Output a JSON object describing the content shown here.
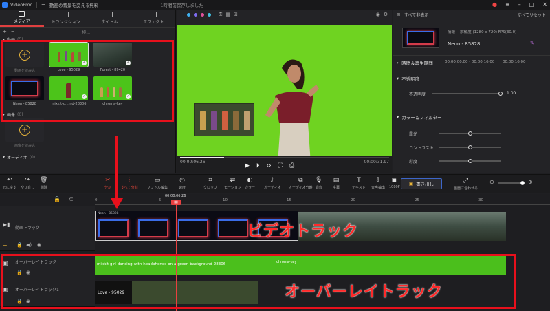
{
  "app": {
    "name": "VideoProc",
    "project_title": "動画の背景を変える無料",
    "status": "1時間前保存しました"
  },
  "left_panel": {
    "tabs": [
      {
        "label": "メディア",
        "icon": "media-icon"
      },
      {
        "label": "トランジション",
        "icon": "transition-icon"
      },
      {
        "label": "タイトル",
        "icon": "title-icon"
      },
      {
        "label": "エフェクト",
        "icon": "effect-icon"
      }
    ],
    "search_placeholder": "検...",
    "video_section": {
      "label": "動画",
      "count": "(5)"
    },
    "media": [
      {
        "label": "動画を読み込",
        "type": "add"
      },
      {
        "label": "Love - 95029",
        "type": "green",
        "selected": true
      },
      {
        "label": "Forest - 89420",
        "type": "forest"
      },
      {
        "label": "Neon - 85828",
        "type": "neon"
      },
      {
        "label": "mixkit-g....nd-28306",
        "type": "green"
      },
      {
        "label": "chroma-key",
        "type": "green"
      }
    ],
    "image_section": {
      "label": "画像",
      "count": "(0)"
    },
    "image_add_label": "画像を読み込",
    "audio_section": {
      "label": "オーディオ",
      "count": "(0)"
    }
  },
  "preview": {
    "current_time": "00:00:06.26",
    "total_time": "00:00:31.97",
    "progress": 0.21
  },
  "right_panel": {
    "fullscreen_label": "すべて非表示",
    "reset_label": "すべてリセット",
    "info": "情報： 解像度 (1280 x 720) FPS(30.0)",
    "clip_name": "Neon - 85828",
    "time_section": "時間＆再生時間",
    "time_value": "00:00:00.00 - 00:00:16.00",
    "duration": "00:00:16.00",
    "opacity_section": "不透明度",
    "opacity_label": "不透明度",
    "opacity_value": "1.00",
    "color_section": "カラー＆フィルター",
    "color_items": [
      "露光",
      "コントラスト",
      "彩度"
    ]
  },
  "toolbar": {
    "left": [
      {
        "label": "元に戻す",
        "glyph": "↶"
      },
      {
        "label": "やり直し",
        "glyph": "↷"
      },
      {
        "label": "削除",
        "glyph": "🗑"
      }
    ],
    "tools": [
      {
        "label": "分割",
        "glyph": "✂",
        "red": true
      },
      {
        "label": "すべて分割",
        "glyph": "⫶",
        "red": true
      },
      {
        "label": "ソフトル編集",
        "glyph": "▭"
      },
      {
        "label": "速度",
        "glyph": "◷"
      },
      {
        "label": "クロップ",
        "glyph": "⌗"
      },
      {
        "label": "モーション",
        "glyph": "⇄"
      },
      {
        "label": "カラー",
        "glyph": "◐"
      },
      {
        "label": "オーディオ",
        "glyph": "♪"
      },
      {
        "label": "オーディオ分離",
        "glyph": "⧉"
      },
      {
        "label": "録音",
        "glyph": "🎙"
      },
      {
        "label": "字幕",
        "glyph": "▤"
      },
      {
        "label": "テキスト",
        "glyph": "T"
      },
      {
        "label": "音声抽出",
        "glyph": "⇩"
      },
      {
        "label": "1080P",
        "glyph": "▣"
      }
    ],
    "export_label": "書き出し",
    "fit_label": "画面に合わせる"
  },
  "timeline": {
    "ruler": [
      "0",
      "5",
      "10",
      "15",
      "20",
      "25",
      "30"
    ],
    "playhead": "00:00:06.26",
    "tracks": [
      {
        "name": "動画トラック",
        "clip_label": "Neon - 85828"
      },
      {
        "name": "オーバーレイトラック",
        "clip_label": "mixkit-girl-dancing-with-headphones-on-a-green-background-28306",
        "clip2_label": "chroma-key"
      },
      {
        "name": "オーバーレイトラック1",
        "clip_label": "Love - 95029"
      }
    ],
    "annotations": {
      "video_track": "ビデオトラック",
      "overlay_track": "オーバーレイトラック"
    }
  }
}
